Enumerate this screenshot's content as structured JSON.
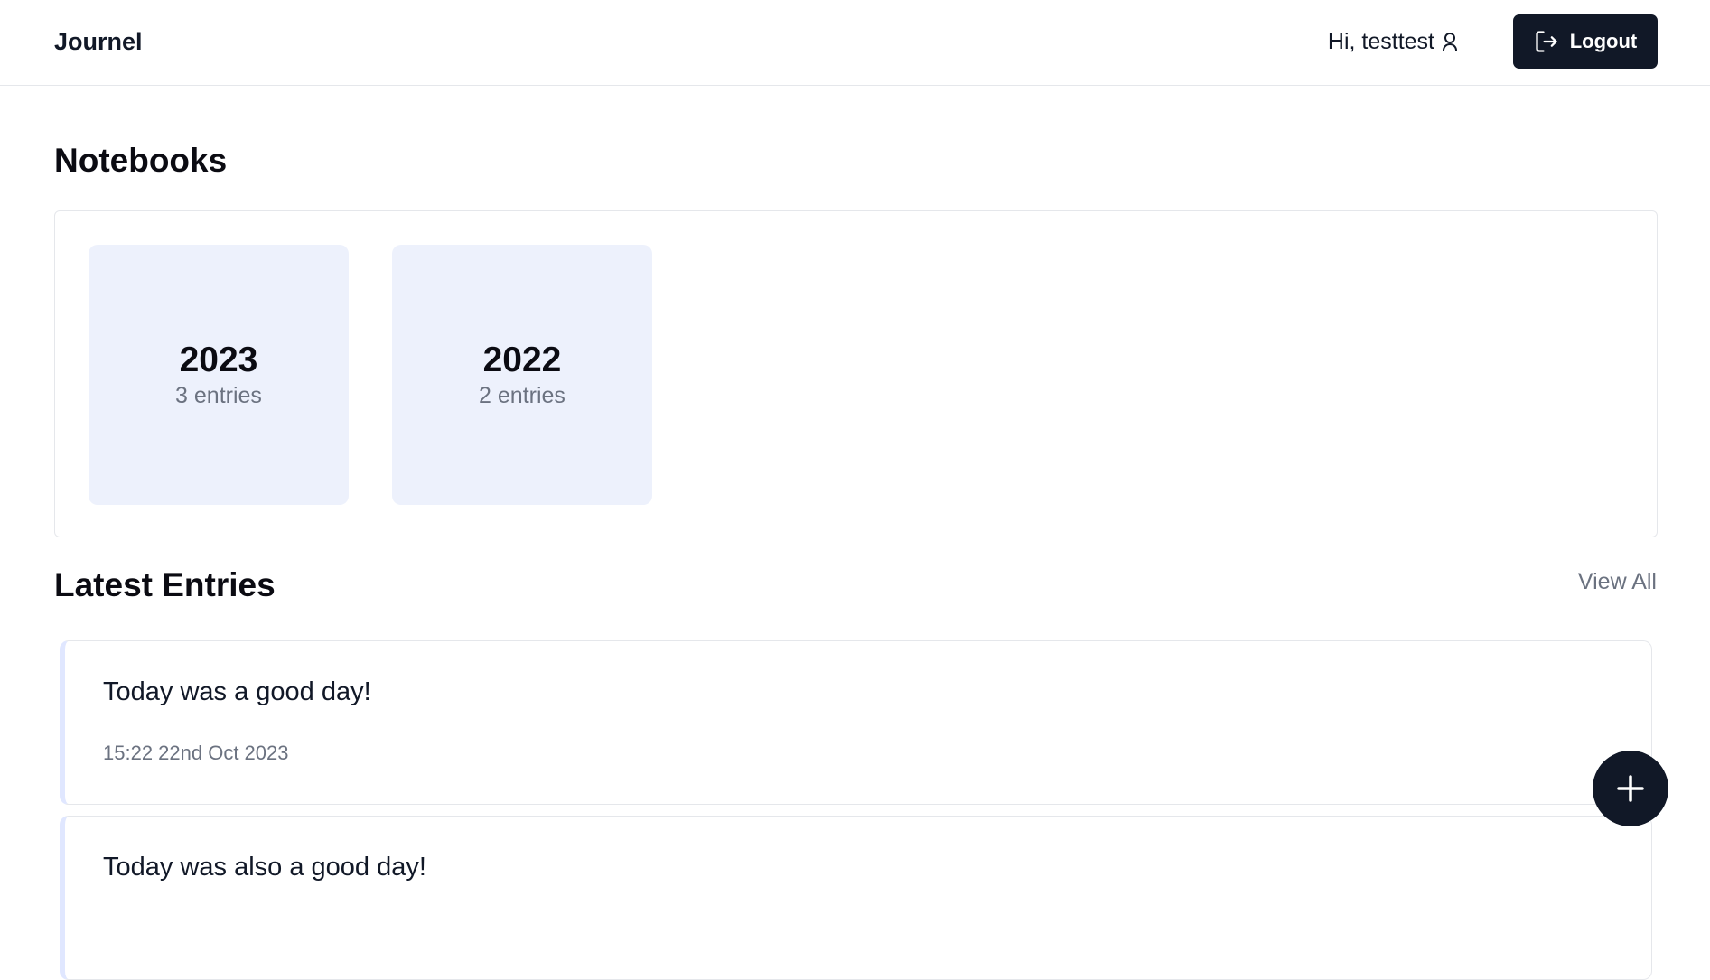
{
  "header": {
    "brand": "Journel",
    "greeting": "Hi, testtest",
    "user_icon": "user-icon",
    "logout_label": "Logout",
    "logout_icon": "logout-icon"
  },
  "notebooks": {
    "title": "Notebooks",
    "items": [
      {
        "year": "2023",
        "count": "3 entries"
      },
      {
        "year": "2022",
        "count": "2 entries"
      }
    ]
  },
  "latest": {
    "title": "Latest Entries",
    "view_all": "View All",
    "entries": [
      {
        "title": "Today was a good day!",
        "time": "15:22 22nd Oct 2023"
      },
      {
        "title": "Today was also a good day!",
        "time": ""
      }
    ]
  },
  "fab": {
    "icon": "plus-icon"
  },
  "colors": {
    "primary_dark": "#111827",
    "card_bg": "#edf1fc",
    "muted_text": "#6b7280",
    "border": "#e5e7eb",
    "entry_accent": "#e0e7ff"
  }
}
